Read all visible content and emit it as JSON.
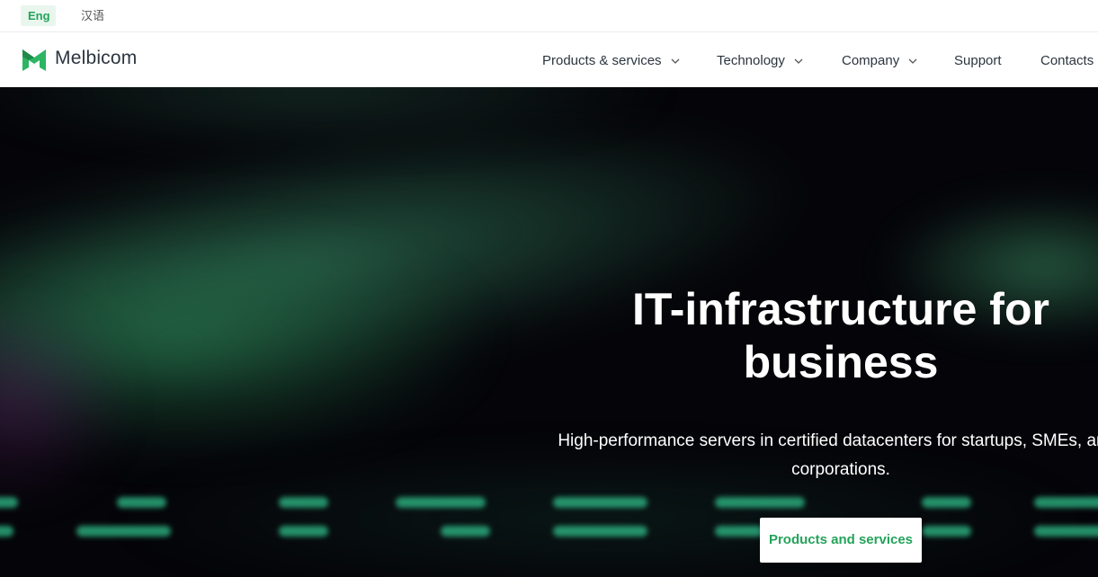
{
  "language": {
    "active": "Eng",
    "other": "汉语"
  },
  "brand": {
    "name": "Melbicom",
    "accent": "#24a35a"
  },
  "nav": {
    "items": [
      {
        "label": "Products & services",
        "has_dropdown": true
      },
      {
        "label": "Technology",
        "has_dropdown": true
      },
      {
        "label": "Company",
        "has_dropdown": true
      },
      {
        "label": "Support",
        "has_dropdown": false
      },
      {
        "label": "Contacts",
        "has_dropdown": false
      }
    ]
  },
  "hero": {
    "title_line1": "IT-infrastructure for",
    "title_line2": "business",
    "subtitle_line1": "High-performance servers in certified datacenters for startups, SMEs, and l",
    "subtitle_line2": "corporations.",
    "cta_label": "Products and services"
  }
}
